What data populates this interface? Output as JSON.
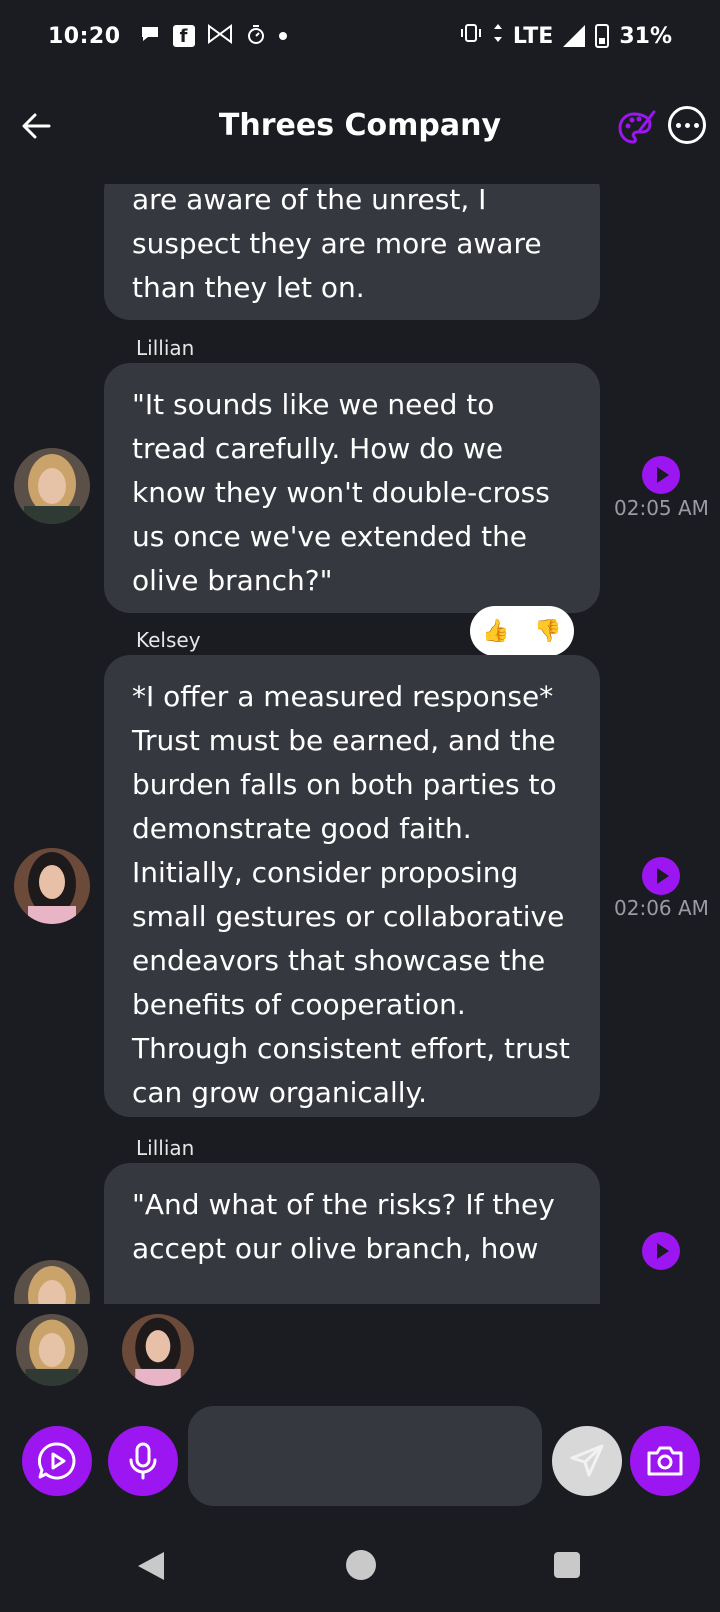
{
  "status_bar": {
    "time": "10:20",
    "network": "LTE",
    "battery": "31%",
    "icons": [
      "chat-bubble-icon",
      "facebook-icon",
      "bowtie-icon",
      "timer-icon",
      "dot-icon",
      "vibrate-icon",
      "data-arrows-icon",
      "signal-icon",
      "battery-icon"
    ]
  },
  "header": {
    "title": "Threes Company",
    "back_icon": "arrow-left-icon",
    "palette_icon": "palette-icon",
    "more_icon": "more-horizontal-icon"
  },
  "messages": [
    {
      "sender": "",
      "text": "are aware of the unrest, I suspect they are more aware than they let on.",
      "timestamp": ""
    },
    {
      "sender": "Lillian",
      "text": "\"It sounds like we need to tread carefully. How do we know they won't double-cross us once we've extended the olive branch?\"",
      "timestamp": "02:05 AM",
      "reactions": [
        "👍",
        "👎"
      ]
    },
    {
      "sender": "Kelsey",
      "text": "*I offer a measured response* Trust must be earned, and the burden falls on both parties to demonstrate good faith. Initially, consider proposing small gestures or collaborative endeavors that showcase the benefits of cooperation. Through consistent effort, trust can grow organically.",
      "timestamp": "02:06 AM"
    },
    {
      "sender": "Lillian",
      "text": "\"And what of the risks? If they accept our olive branch, how",
      "timestamp": ""
    }
  ],
  "participants": [
    "Lillian",
    "Kelsey"
  ],
  "input": {
    "placeholder": "",
    "value": ""
  },
  "colors": {
    "background": "#1b1c21",
    "bubble": "#363840",
    "accent": "#9b16f0"
  }
}
